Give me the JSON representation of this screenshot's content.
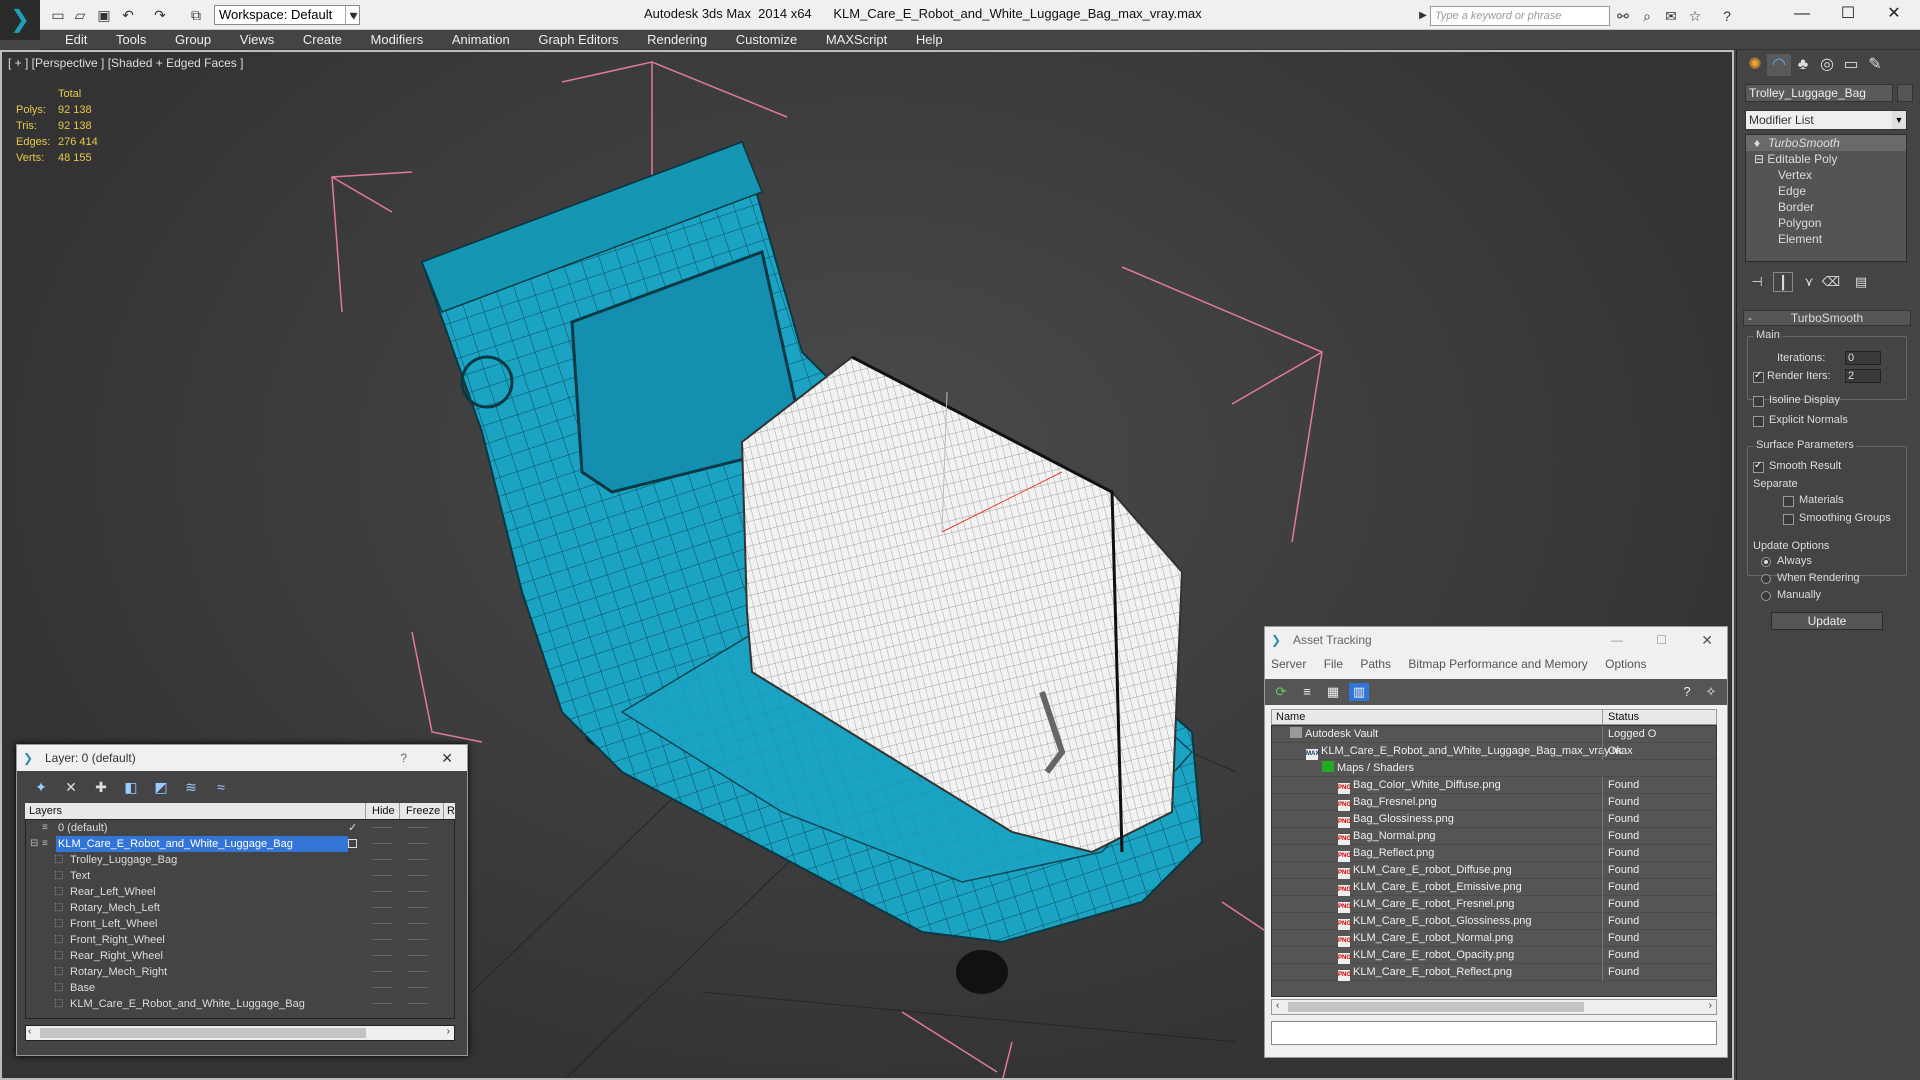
{
  "titlebar": {
    "workspace": "Workspace: Default",
    "app_name": "Autodesk 3ds Max  2014 x64",
    "file_name": "KLM_Care_E_Robot_and_White_Luggage_Bag_max_vray.max",
    "search_placeholder": "Type a keyword or phrase"
  },
  "menu": [
    "Edit",
    "Tools",
    "Group",
    "Views",
    "Create",
    "Modifiers",
    "Animation",
    "Graph Editors",
    "Rendering",
    "Customize",
    "MAXScript",
    "Help"
  ],
  "viewport": {
    "label": "[ + ] [Perspective ] [Shaded + Edged Faces ]",
    "stats": {
      "header": "Total",
      "rows": [
        {
          "k": "Polys:",
          "v": "92 138"
        },
        {
          "k": "Tris:",
          "v": "92 138"
        },
        {
          "k": "Edges:",
          "v": "276 414"
        },
        {
          "k": "Verts:",
          "v": "48 155"
        }
      ]
    }
  },
  "command_panel": {
    "object_name": "Trolley_Luggage_Bag",
    "modifier_list": "Modifier List",
    "stack": [
      "TurboSmooth",
      "Editable Poly",
      "Vertex",
      "Edge",
      "Border",
      "Polygon",
      "Element"
    ],
    "rollout_title": "TurboSmooth",
    "main_label": "Main",
    "iterations_label": "Iterations:",
    "iterations_value": "0",
    "render_iters_label": "Render Iters:",
    "render_iters_value": "2",
    "isoline": "Isoline Display",
    "explicit": "Explicit Normals",
    "surface_params": "Surface Parameters",
    "smooth_result": "Smooth Result",
    "separate": "Separate",
    "materials": "Materials",
    "smoothing_groups": "Smoothing Groups",
    "update_options": "Update Options",
    "always": "Always",
    "when_rendering": "When Rendering",
    "manually": "Manually",
    "update_button": "Update"
  },
  "layer_window": {
    "title": "Layer: 0 (default)",
    "help": "?",
    "col_layers": "Layers",
    "col_hide": "Hide",
    "col_freeze": "Freeze",
    "col_r": "R",
    "rows": [
      {
        "name": "0 (default)",
        "level": 1
      },
      {
        "name": "KLM_Care_E_Robot_and_White_Luggage_Bag",
        "level": 1
      },
      {
        "name": "Trolley_Luggage_Bag",
        "level": 2
      },
      {
        "name": "Text",
        "level": 2
      },
      {
        "name": "Rear_Left_Wheel",
        "level": 2
      },
      {
        "name": "Rotary_Mech_Left",
        "level": 2
      },
      {
        "name": "Front_Left_Wheel",
        "level": 2
      },
      {
        "name": "Front_Right_Wheel",
        "level": 2
      },
      {
        "name": "Rear_Right_Wheel",
        "level": 2
      },
      {
        "name": "Rotary_Mech_Right",
        "level": 2
      },
      {
        "name": "Base",
        "level": 2
      },
      {
        "name": "KLM_Care_E_Robot_and_White_Luggage_Bag",
        "level": 2
      }
    ]
  },
  "asset_window": {
    "title": "Asset Tracking",
    "menu": [
      "Server",
      "File",
      "Paths",
      "Bitmap Performance and Memory",
      "Options"
    ],
    "col_name": "Name",
    "col_status": "Status",
    "rows": [
      {
        "name": "Autodesk Vault",
        "status": "Logged O",
        "level": 0
      },
      {
        "name": "KLM_Care_E_Robot_and_White_Luggage_Bag_max_vray.max",
        "status": "Ok",
        "level": 1
      },
      {
        "name": "Maps / Shaders",
        "status": "",
        "level": 2
      },
      {
        "name": "Bag_Color_White_Diffuse.png",
        "status": "Found",
        "level": 3
      },
      {
        "name": "Bag_Fresnel.png",
        "status": "Found",
        "level": 3
      },
      {
        "name": "Bag_Glossiness.png",
        "status": "Found",
        "level": 3
      },
      {
        "name": "Bag_Normal.png",
        "status": "Found",
        "level": 3
      },
      {
        "name": "Bag_Reflect.png",
        "status": "Found",
        "level": 3
      },
      {
        "name": "KLM_Care_E_robot_Diffuse.png",
        "status": "Found",
        "level": 3
      },
      {
        "name": "KLM_Care_E_robot_Emissive.png",
        "status": "Found",
        "level": 3
      },
      {
        "name": "KLM_Care_E_robot_Fresnel.png",
        "status": "Found",
        "level": 3
      },
      {
        "name": "KLM_Care_E_robot_Glossiness.png",
        "status": "Found",
        "level": 3
      },
      {
        "name": "KLM_Care_E_robot_Normal.png",
        "status": "Found",
        "level": 3
      },
      {
        "name": "KLM_Care_E_robot_Opacity.png",
        "status": "Found",
        "level": 3
      },
      {
        "name": "KLM_Care_E_robot_Reflect.png",
        "status": "Found",
        "level": 3
      }
    ]
  },
  "colors": {
    "robot": "#1aa3c2",
    "wire": "#0d4a5a",
    "luggage": "#f2f2f2",
    "selection_box": "#e07a9a",
    "stats": "#e8c84a",
    "layer_selected": "#3375d6"
  }
}
